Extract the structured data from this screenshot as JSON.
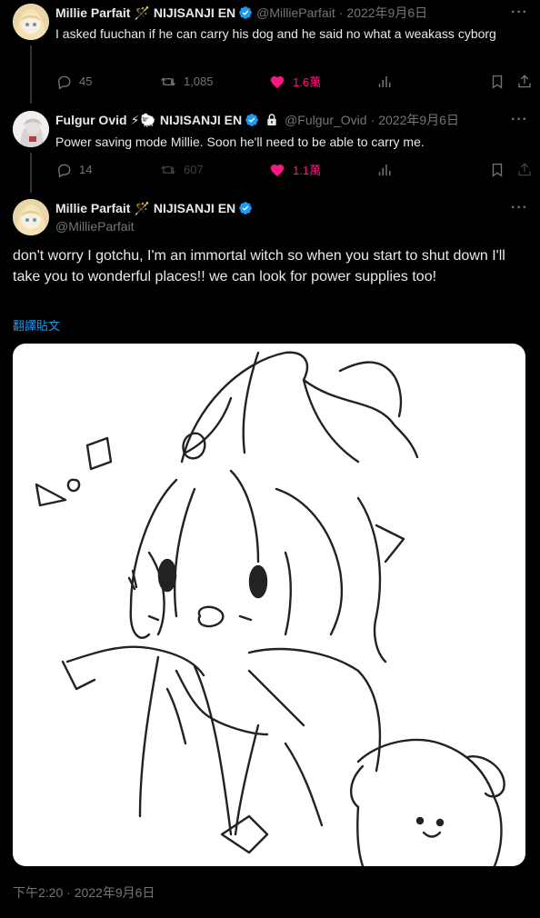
{
  "tweets": [
    {
      "name": "Millie Parfait",
      "org": "NIJISANJI EN",
      "handle": "@MillieParfait",
      "date": "2022年9月6日",
      "text": "I asked fuuchan if he can carry his dog and he said no what a weakass cyborg",
      "replies": "45",
      "retweets": "1,085",
      "likes": "1.6萬"
    },
    {
      "name": "Fulgur Ovid",
      "org": "NIJISANJI EN",
      "handle": "@Fulgur_Ovid",
      "date": "2022年9月6日",
      "text": "Power saving mode Millie. Soon he'll need to be able to carry me.",
      "replies": "14",
      "retweets": "607",
      "likes": "1.1萬"
    }
  ],
  "main": {
    "name": "Millie Parfait",
    "org": "NIJISANJI EN",
    "handle": "@MillieParfait",
    "text": "don't worry I gotchu, I'm an immortal witch so when you start to shut down I'll take you to wonderful places!! we can look for power supplies too!",
    "translate": "翻譯貼文",
    "timestamp": "下午2:20 · 2022年9月6日"
  },
  "emojis": {
    "wand": "🪄",
    "bolt": "⚡",
    "sheep": "🐑",
    "lock": "🔒",
    "dot": "·"
  },
  "colors": {
    "background": "#000000",
    "text": "#e7e9ea",
    "muted": "#71767b",
    "verified": "#1d9bf0",
    "like": "#f91880",
    "link": "#1d9bf0"
  }
}
